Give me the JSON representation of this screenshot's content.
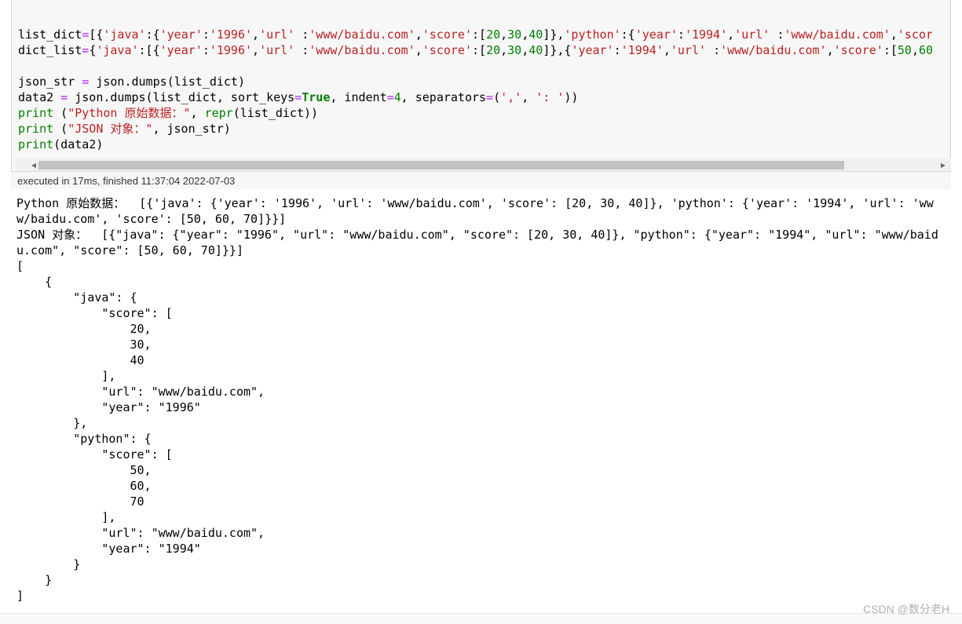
{
  "code_cell": {
    "lines": [
      [
        [
          "v",
          "list_dict"
        ],
        [
          "o",
          "="
        ],
        [
          "v",
          "[{"
        ],
        [
          "s",
          "'java'"
        ],
        [
          "v",
          ":{"
        ],
        [
          "s",
          "'year'"
        ],
        [
          "v",
          ":"
        ],
        [
          "s",
          "'1996'"
        ],
        [
          "v",
          ","
        ],
        [
          "s",
          "'url' "
        ],
        [
          "v",
          ":"
        ],
        [
          "s",
          "'www/baidu.com'"
        ],
        [
          "v",
          ","
        ],
        [
          "s",
          "'score'"
        ],
        [
          "v",
          ":["
        ],
        [
          "n",
          "20"
        ],
        [
          "v",
          ","
        ],
        [
          "n",
          "30"
        ],
        [
          "v",
          ","
        ],
        [
          "n",
          "40"
        ],
        [
          "v",
          "]},"
        ],
        [
          "s",
          "'python'"
        ],
        [
          "v",
          ":{"
        ],
        [
          "s",
          "'year'"
        ],
        [
          "v",
          ":"
        ],
        [
          "s",
          "'1994'"
        ],
        [
          "v",
          ","
        ],
        [
          "s",
          "'url' "
        ],
        [
          "v",
          ":"
        ],
        [
          "s",
          "'www/baidu.com'"
        ],
        [
          "v",
          ","
        ],
        [
          "s",
          "'score'"
        ]
      ],
      [
        [
          "v",
          "dict_list"
        ],
        [
          "o",
          "="
        ],
        [
          "v",
          "{"
        ],
        [
          "s",
          "'java'"
        ],
        [
          "v",
          ":[{"
        ],
        [
          "s",
          "'year'"
        ],
        [
          "v",
          ":"
        ],
        [
          "s",
          "'1996'"
        ],
        [
          "v",
          ","
        ],
        [
          "s",
          "'url' "
        ],
        [
          "v",
          ":"
        ],
        [
          "s",
          "'www/baidu.com'"
        ],
        [
          "v",
          ","
        ],
        [
          "s",
          "'score'"
        ],
        [
          "v",
          ":["
        ],
        [
          "n",
          "20"
        ],
        [
          "v",
          ","
        ],
        [
          "n",
          "30"
        ],
        [
          "v",
          ","
        ],
        [
          "n",
          "40"
        ],
        [
          "v",
          "]},{"
        ],
        [
          "s",
          "'year'"
        ],
        [
          "v",
          ":"
        ],
        [
          "s",
          "'1994'"
        ],
        [
          "v",
          ","
        ],
        [
          "s",
          "'url' "
        ],
        [
          "v",
          ":"
        ],
        [
          "s",
          "'www/baidu.com'"
        ],
        [
          "v",
          ","
        ],
        [
          "s",
          "'score'"
        ],
        [
          "v",
          ":["
        ],
        [
          "n",
          "50"
        ],
        [
          "v",
          ","
        ],
        [
          "n",
          "60"
        ],
        [
          "v",
          ",'"
        ]
      ],
      [],
      [
        [
          "v",
          "json_str "
        ],
        [
          "o",
          "="
        ],
        [
          "v",
          " json.dumps(list_dict)"
        ]
      ],
      [
        [
          "v",
          "data2 "
        ],
        [
          "o",
          "="
        ],
        [
          "v",
          " json.dumps(list_dict, sort_keys"
        ],
        [
          "o",
          "="
        ],
        [
          "k",
          "True"
        ],
        [
          "v",
          ", indent"
        ],
        [
          "o",
          "="
        ],
        [
          "n",
          "4"
        ],
        [
          "v",
          ", separators"
        ],
        [
          "o",
          "="
        ],
        [
          "v",
          "("
        ],
        [
          "s",
          "','"
        ],
        [
          "v",
          ", "
        ],
        [
          "s",
          "': '"
        ],
        [
          "v",
          "))"
        ]
      ],
      [
        [
          "b",
          "print"
        ],
        [
          "v",
          " ("
        ],
        [
          "s",
          "\"Python 原始数据：\""
        ],
        [
          "v",
          ", "
        ],
        [
          "b",
          "repr"
        ],
        [
          "v",
          "(list_dict))"
        ]
      ],
      [
        [
          "b",
          "print"
        ],
        [
          "v",
          " ("
        ],
        [
          "s",
          "\"JSON 对象：\""
        ],
        [
          "v",
          ", json_str)"
        ]
      ],
      [
        [
          "b",
          "print"
        ],
        [
          "v",
          "(data2)"
        ]
      ]
    ],
    "exec_status": "executed in 17ms, finished 11:37:04 2022-07-03"
  },
  "output_lines": [
    "Python 原始数据：  [{'java': {'year': '1996', 'url': 'www/baidu.com', 'score': [20, 30, 40]}, 'python': {'year': '1994', 'url': 'ww",
    "w/baidu.com', 'score': [50, 60, 70]}}]",
    "JSON 对象：  [{\"java\": {\"year\": \"1996\", \"url\": \"www/baidu.com\", \"score\": [20, 30, 40]}, \"python\": {\"year\": \"1994\", \"url\": \"www/baid",
    "u.com\", \"score\": [50, 60, 70]}}]",
    "[",
    "    {",
    "        \"java\": {",
    "            \"score\": [",
    "                20,",
    "                30,",
    "                40",
    "            ],",
    "            \"url\": \"www/baidu.com\",",
    "            \"year\": \"1996\"",
    "        },",
    "        \"python\": {",
    "            \"score\": [",
    "                50,",
    "                60,",
    "                70",
    "            ],",
    "            \"url\": \"www/baidu.com\",",
    "            \"year\": \"1994\"",
    "        }",
    "    }",
    "]"
  ],
  "watermark": "CSDN @数分老H"
}
